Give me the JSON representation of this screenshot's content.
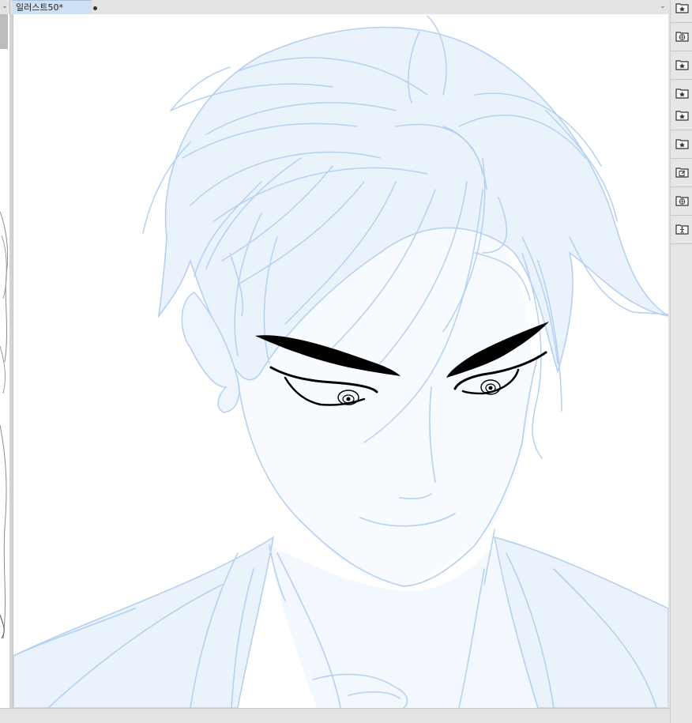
{
  "document_tab": {
    "title": "일러스트50*"
  },
  "right_toolbar": {
    "buttons": [
      {
        "icon": "favorite-folder-icon"
      },
      {
        "icon": "3d-material-folder-icon"
      },
      {
        "icon": "favorite-folder-icon"
      },
      {
        "icon": "favorite-folder-icon"
      },
      {
        "icon": "favorite-folder-icon"
      },
      {
        "icon": "favorite-folder-icon"
      },
      {
        "icon": "edit-folder-icon"
      },
      {
        "icon": "3d-material-folder-icon"
      },
      {
        "icon": "pose-folder-icon"
      }
    ]
  },
  "colors": {
    "sketch_line": "#b5d1f0",
    "sketch_fill": "#eaf2fc",
    "ink": "#000000",
    "tab_active": "#cfe0f2"
  }
}
